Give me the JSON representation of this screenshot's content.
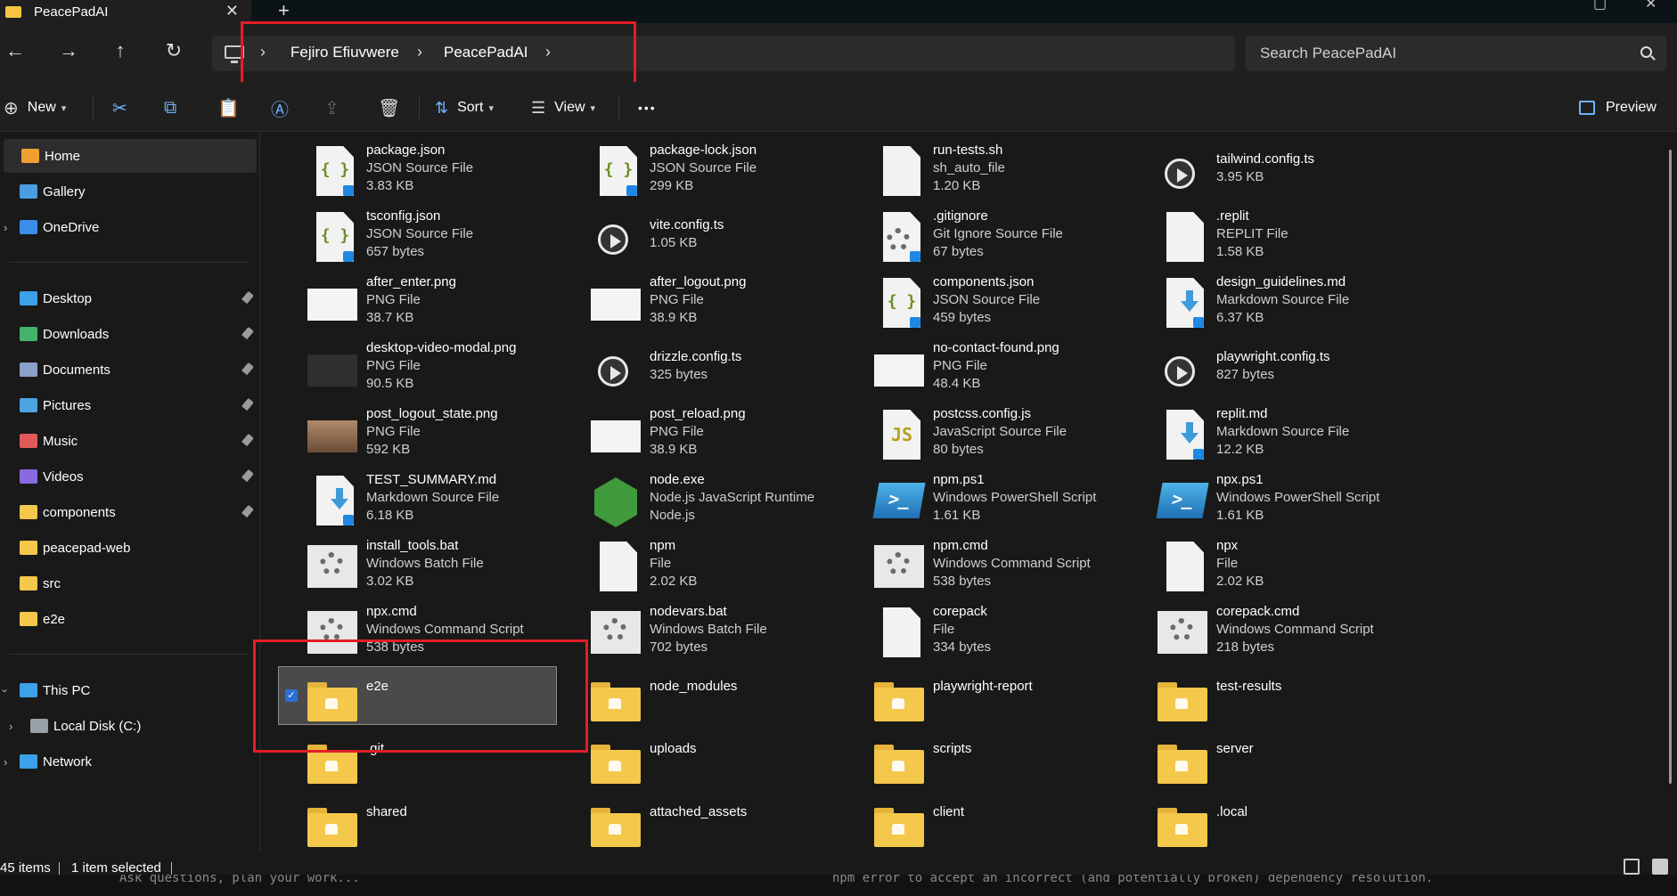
{
  "window": {
    "tab_title": "PeacePadAI"
  },
  "breadcrumbs": [
    "Fejiro Efiuvwere",
    "PeacePadAI"
  ],
  "search": {
    "placeholder": "Search PeacePadAI"
  },
  "toolbar": {
    "new_label": "New",
    "sort_label": "Sort",
    "view_label": "View",
    "more_label": "•••",
    "preview_label": "Preview"
  },
  "sidebar": {
    "top": [
      {
        "label": "Home",
        "icon": "home-icon",
        "color": "#f0a030"
      },
      {
        "label": "Gallery",
        "icon": "gallery-icon",
        "color": "#4a9de0"
      },
      {
        "label": "OneDrive",
        "icon": "cloud-icon",
        "color": "#3a8fe8"
      }
    ],
    "pinned": [
      {
        "label": "Desktop",
        "icon": "desktop-icon",
        "color": "#3ea0e8"
      },
      {
        "label": "Downloads",
        "icon": "download-icon",
        "color": "#43b36b"
      },
      {
        "label": "Documents",
        "icon": "documents-icon",
        "color": "#8ba0c8"
      },
      {
        "label": "Pictures",
        "icon": "pictures-icon",
        "color": "#4aa5e0"
      },
      {
        "label": "Music",
        "icon": "music-icon",
        "color": "#e05a5a"
      },
      {
        "label": "Videos",
        "icon": "videos-icon",
        "color": "#8a6ae0"
      },
      {
        "label": "components",
        "icon": "folder-icon",
        "color": "#f4c84a"
      },
      {
        "label": "peacepad-web",
        "icon": "folder-icon",
        "color": "#f4c84a"
      },
      {
        "label": "src",
        "icon": "folder-icon",
        "color": "#f4c84a"
      },
      {
        "label": "e2e",
        "icon": "folder-icon",
        "color": "#f4c84a"
      }
    ],
    "bottom": [
      {
        "label": "This PC",
        "icon": "pc-icon",
        "color": "#3ea0e8"
      },
      {
        "label": "Local Disk (C:)",
        "icon": "disk-icon",
        "color": "#9aa0a8"
      },
      {
        "label": "Network",
        "icon": "network-icon",
        "color": "#3ea0e8"
      }
    ]
  },
  "files": [
    {
      "name": "package.json",
      "type": "JSON Source File",
      "size": "3.83 KB",
      "icon": "json"
    },
    {
      "name": "package-lock.json",
      "type": "JSON Source File",
      "size": "299 KB",
      "icon": "json"
    },
    {
      "name": "run-tests.sh",
      "type": "sh_auto_file",
      "size": "1.20 KB",
      "icon": "blank"
    },
    {
      "name": "tailwind.config.ts",
      "type": "",
      "size": "3.95 KB",
      "icon": "vite"
    },
    {
      "name": "tsconfig.json",
      "type": "JSON Source File",
      "size": "657 bytes",
      "icon": "json"
    },
    {
      "name": "vite.config.ts",
      "type": "",
      "size": "1.05 KB",
      "icon": "vite"
    },
    {
      "name": ".gitignore",
      "type": "Git Ignore Source File",
      "size": "67 bytes",
      "icon": "gear"
    },
    {
      "name": ".replit",
      "type": "REPLIT File",
      "size": "1.58 KB",
      "icon": "blank"
    },
    {
      "name": "after_enter.png",
      "type": "PNG File",
      "size": "38.7 KB",
      "icon": "img"
    },
    {
      "name": "after_logout.png",
      "type": "PNG File",
      "size": "38.9 KB",
      "icon": "img"
    },
    {
      "name": "components.json",
      "type": "JSON Source File",
      "size": "459 bytes",
      "icon": "json"
    },
    {
      "name": "design_guidelines.md",
      "type": "Markdown Source File",
      "size": "6.37 KB",
      "icon": "md"
    },
    {
      "name": "desktop-video-modal.png",
      "type": "PNG File",
      "size": "90.5 KB",
      "icon": "img-dark"
    },
    {
      "name": "drizzle.config.ts",
      "type": "",
      "size": "325 bytes",
      "icon": "vite"
    },
    {
      "name": "no-contact-found.png",
      "type": "PNG File",
      "size": "48.4 KB",
      "icon": "img"
    },
    {
      "name": "playwright.config.ts",
      "type": "",
      "size": "827 bytes",
      "icon": "vite"
    },
    {
      "name": "post_logout_state.png",
      "type": "PNG File",
      "size": "592 KB",
      "icon": "img-brown"
    },
    {
      "name": "post_reload.png",
      "type": "PNG File",
      "size": "38.9 KB",
      "icon": "img"
    },
    {
      "name": "postcss.config.js",
      "type": "JavaScript Source File",
      "size": "80 bytes",
      "icon": "js"
    },
    {
      "name": "replit.md",
      "type": "Markdown Source File",
      "size": "12.2 KB",
      "icon": "md"
    },
    {
      "name": "TEST_SUMMARY.md",
      "type": "Markdown Source File",
      "size": "6.18 KB",
      "icon": "md"
    },
    {
      "name": "node.exe",
      "type": "Node.js JavaScript Runtime",
      "size": "Node.js",
      "icon": "node"
    },
    {
      "name": "npm.ps1",
      "type": "Windows PowerShell Script",
      "size": "1.61 KB",
      "icon": "ps"
    },
    {
      "name": "npx.ps1",
      "type": "Windows PowerShell Script",
      "size": "1.61 KB",
      "icon": "ps"
    },
    {
      "name": "install_tools.bat",
      "type": "Windows Batch File",
      "size": "3.02 KB",
      "icon": "bat"
    },
    {
      "name": "npm",
      "type": "File",
      "size": "2.02 KB",
      "icon": "blank"
    },
    {
      "name": "npm.cmd",
      "type": "Windows Command Script",
      "size": "538 bytes",
      "icon": "bat"
    },
    {
      "name": "npx",
      "type": "File",
      "size": "2.02 KB",
      "icon": "blank"
    },
    {
      "name": "npx.cmd",
      "type": "Windows Command Script",
      "size": "538 bytes",
      "icon": "bat"
    },
    {
      "name": "nodevars.bat",
      "type": "Windows Batch File",
      "size": "702 bytes",
      "icon": "bat"
    },
    {
      "name": "corepack",
      "type": "File",
      "size": "334 bytes",
      "icon": "blank"
    },
    {
      "name": "corepack.cmd",
      "type": "Windows Command Script",
      "size": "218 bytes",
      "icon": "bat"
    },
    {
      "name": "e2e",
      "type": "",
      "size": "",
      "icon": "folder"
    },
    {
      "name": "node_modules",
      "type": "",
      "size": "",
      "icon": "folder"
    },
    {
      "name": "playwright-report",
      "type": "",
      "size": "",
      "icon": "folder"
    },
    {
      "name": "test-results",
      "type": "",
      "size": "",
      "icon": "folder"
    },
    {
      "name": ".git",
      "type": "",
      "size": "",
      "icon": "folder"
    },
    {
      "name": "uploads",
      "type": "",
      "size": "",
      "icon": "folder"
    },
    {
      "name": "scripts",
      "type": "",
      "size": "",
      "icon": "folder"
    },
    {
      "name": "server",
      "type": "",
      "size": "",
      "icon": "folder"
    },
    {
      "name": "shared",
      "type": "",
      "size": "",
      "icon": "folder"
    },
    {
      "name": "attached_assets",
      "type": "",
      "size": "",
      "icon": "folder"
    },
    {
      "name": "client",
      "type": "",
      "size": "",
      "icon": "folder"
    },
    {
      "name": ".local",
      "type": "",
      "size": "",
      "icon": "folder"
    }
  ],
  "selected_file": "e2e",
  "status": {
    "count": "45 items",
    "selected": "1 item selected"
  },
  "background_strip": {
    "left": "Ask questions, plan your work...",
    "right": "npm error to accept an incorrect (and potentially broken) dependency resolution."
  },
  "colors": {
    "highlight": "#e21e26",
    "accent": "#2b6fd6"
  }
}
